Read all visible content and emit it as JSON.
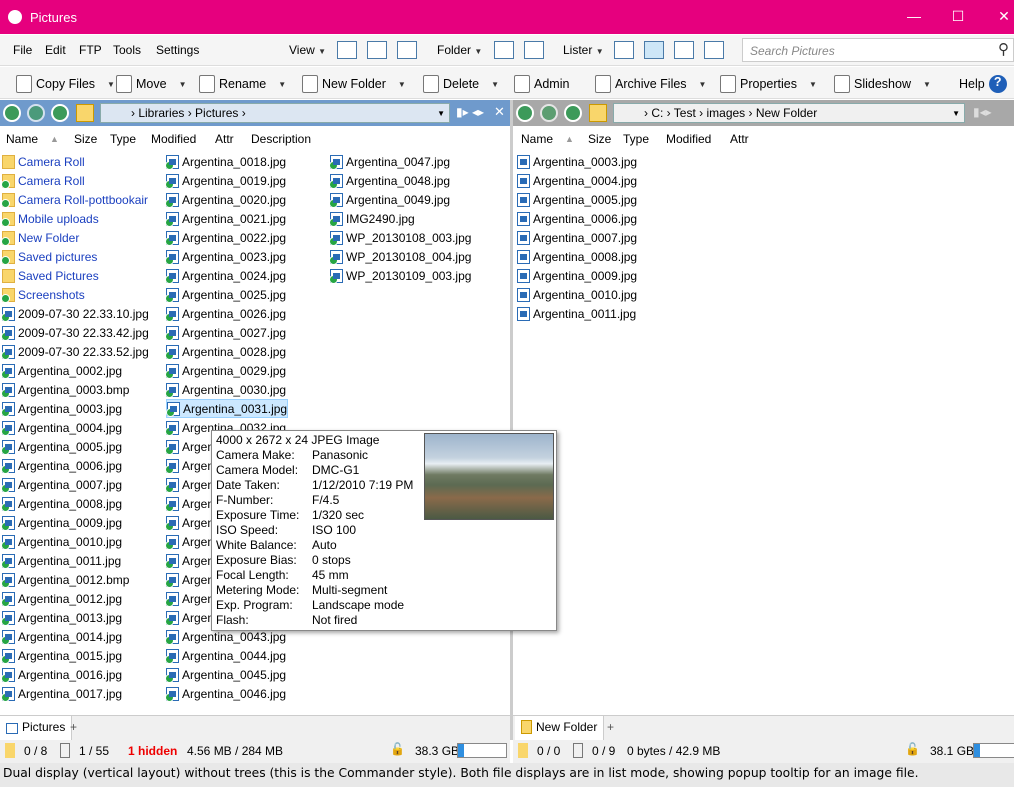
{
  "window": {
    "title": "Pictures",
    "controls": [
      "—",
      "☐",
      "✕"
    ]
  },
  "menu": [
    "File",
    "Edit",
    "FTP",
    "Tools",
    "Settings"
  ],
  "view_groups": [
    {
      "label": "View"
    },
    {
      "label": "Folder"
    },
    {
      "label": "Lister"
    }
  ],
  "search": {
    "placeholder": "Search Pictures"
  },
  "toolbar": [
    "Copy Files",
    "Move",
    "Rename",
    "New Folder",
    "Delete",
    "Admin",
    "Archive Files",
    "Properties",
    "Slideshow",
    "Help"
  ],
  "left": {
    "path": [
      "Libraries",
      "Pictures"
    ],
    "columns": [
      "Name",
      "Size",
      "Type",
      "Modified",
      "Attr",
      "Description"
    ],
    "files": [
      {
        "n": "Camera Roll",
        "t": "folder"
      },
      {
        "n": "Camera Roll",
        "t": "folder",
        "c": true
      },
      {
        "n": "Camera Roll-pottbookair",
        "t": "folder",
        "c": true
      },
      {
        "n": "Mobile uploads",
        "t": "folder",
        "c": true
      },
      {
        "n": "New Folder",
        "t": "folder",
        "c": true
      },
      {
        "n": "Saved pictures",
        "t": "folder",
        "c": true
      },
      {
        "n": "Saved Pictures",
        "t": "folder"
      },
      {
        "n": "Screenshots",
        "t": "folder",
        "c": true
      },
      {
        "n": "2009-07-30 22.33.10.jpg"
      },
      {
        "n": "2009-07-30 22.33.42.jpg"
      },
      {
        "n": "2009-07-30 22.33.52.jpg"
      },
      {
        "n": "Argentina_0002.jpg"
      },
      {
        "n": "Argentina_0003.bmp"
      },
      {
        "n": "Argentina_0003.jpg"
      },
      {
        "n": "Argentina_0004.jpg"
      },
      {
        "n": "Argentina_0005.jpg"
      },
      {
        "n": "Argentina_0006.jpg"
      },
      {
        "n": "Argentina_0007.jpg"
      },
      {
        "n": "Argentina_0008.jpg"
      },
      {
        "n": "Argentina_0009.jpg"
      },
      {
        "n": "Argentina_0010.jpg"
      },
      {
        "n": "Argentina_0011.jpg"
      },
      {
        "n": "Argentina_0012.bmp"
      },
      {
        "n": "Argentina_0012.jpg"
      },
      {
        "n": "Argentina_0013.jpg"
      },
      {
        "n": "Argentina_0014.jpg"
      },
      {
        "n": "Argentina_0015.jpg"
      },
      {
        "n": "Argentina_0016.jpg"
      },
      {
        "n": "Argentina_0017.jpg"
      },
      {
        "n": "Argentina_0018.jpg"
      },
      {
        "n": "Argentina_0019.jpg"
      },
      {
        "n": "Argentina_0020.jpg"
      },
      {
        "n": "Argentina_0021.jpg"
      },
      {
        "n": "Argentina_0022.jpg"
      },
      {
        "n": "Argentina_0023.jpg"
      },
      {
        "n": "Argentina_0024.jpg"
      },
      {
        "n": "Argentina_0025.jpg"
      },
      {
        "n": "Argentina_0026.jpg"
      },
      {
        "n": "Argentina_0027.jpg"
      },
      {
        "n": "Argentina_0028.jpg"
      },
      {
        "n": "Argentina_0029.jpg"
      },
      {
        "n": "Argentina_0030.jpg"
      },
      {
        "n": "Argentina_0031.jpg",
        "sel": true
      },
      {
        "n": "Argentina_0032.jpg"
      },
      {
        "n": "Argentina_0033.jpg"
      },
      {
        "n": "Argentina_0034.jpg"
      },
      {
        "n": "Argentina_0035.jpg"
      },
      {
        "n": "Argentina_0036.jpg"
      },
      {
        "n": "Argentina_0037.jpg"
      },
      {
        "n": "Argentina_0038.jpg"
      },
      {
        "n": "Argentina_0039.jpg"
      },
      {
        "n": "Argentina_0040.jpg"
      },
      {
        "n": "Argentina_0041.jpg"
      },
      {
        "n": "Argentina_0042.jpg"
      },
      {
        "n": "Argentina_0043.jpg"
      },
      {
        "n": "Argentina_0044.jpg"
      },
      {
        "n": "Argentina_0045.jpg"
      },
      {
        "n": "Argentina_0046.jpg"
      },
      {
        "n": "Argentina_0047.jpg"
      },
      {
        "n": "Argentina_0048.jpg"
      },
      {
        "n": "Argentina_0049.jpg"
      },
      {
        "n": "IMG2490.jpg"
      },
      {
        "n": "WP_20130108_003.jpg"
      },
      {
        "n": "WP_20130108_004.jpg"
      },
      {
        "n": "WP_20130109_003.jpg"
      }
    ],
    "tab": "Pictures",
    "status": {
      "folders": "0 / 8",
      "files": "1 / 55",
      "hidden": "1 hidden",
      "size": "4.56 MB / 284 MB",
      "free": "38.3 GB",
      "used_pct": 12
    }
  },
  "right": {
    "path": [
      "C:",
      "Test",
      "images",
      "New Folder"
    ],
    "columns": [
      "Name",
      "Size",
      "Type",
      "Modified",
      "Attr"
    ],
    "files": [
      "Argentina_0003.jpg",
      "Argentina_0004.jpg",
      "Argentina_0005.jpg",
      "Argentina_0006.jpg",
      "Argentina_0007.jpg",
      "Argentina_0008.jpg",
      "Argentina_0009.jpg",
      "Argentina_0010.jpg",
      "Argentina_0011.jpg"
    ],
    "tab": "New Folder",
    "status": {
      "folders": "0 / 0",
      "files": "0 / 9",
      "size": "0 bytes / 42.9 MB",
      "free": "38.1 GB",
      "used_pct": 12
    }
  },
  "tooltip": {
    "header": "4000 x 2672 x 24 JPEG Image",
    "rows": [
      [
        "Camera Make:",
        "Panasonic"
      ],
      [
        "Camera Model:",
        "DMC-G1"
      ],
      [
        "Date Taken:",
        "1/12/2010 7:19 PM"
      ],
      [
        "F-Number:",
        "F/4.5"
      ],
      [
        "Exposure Time:",
        "1/320 sec"
      ],
      [
        "ISO Speed:",
        "ISO 100"
      ],
      [
        "White Balance:",
        "Auto"
      ],
      [
        "Exposure Bias:",
        "0 stops"
      ],
      [
        "Focal Length:",
        "45 mm"
      ],
      [
        "Metering Mode:",
        "Multi-segment"
      ],
      [
        "Exp. Program:",
        "Landscape mode"
      ],
      [
        "Flash:",
        "Not fired"
      ]
    ]
  },
  "caption": "Dual display (vertical layout) without trees (this is the Commander style). Both file displays are in list mode, showing popup tooltip for an image file."
}
